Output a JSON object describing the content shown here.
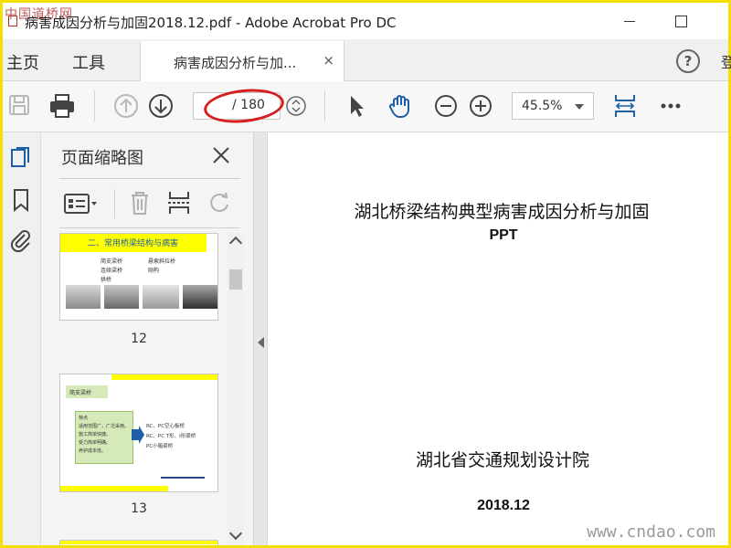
{
  "window": {
    "title": "病害成因分析与加固2018.12.pdf - Adobe Acrobat Pro DC",
    "watermark": "中国道桥网"
  },
  "nav": {
    "home_label": "主页",
    "tools_label": "工具",
    "doc_tab_label": "病害成因分析与加...",
    "doc_tab_close": "×",
    "help_label": "?",
    "login_label": "登"
  },
  "toolbar": {
    "page_total": "/ 180",
    "zoom_value": "45.5%"
  },
  "thumbnail_panel": {
    "title": "页面缩略图",
    "thumbnails": [
      {
        "page_number": "12",
        "heading": "二、常用桥梁结构与病害",
        "bullets_left": [
          "简支梁桥",
          "连续梁桥",
          "拱桥"
        ],
        "bullets_right": [
          "悬索斜拉桥",
          "刚构"
        ]
      },
      {
        "page_number": "13",
        "heading": "简支梁桥",
        "box_title": "特点",
        "box_lines": [
          "适用范围广，广泛采用。",
          "施工简单快捷。",
          "受力简单明确。",
          "养护成本低。"
        ],
        "bullets": [
          "RC、PC空心板桥",
          "RC、PC T形、I形梁桥",
          "PC小箱梁桥"
        ]
      }
    ]
  },
  "document": {
    "title": "湖北桥梁结构典型病害成因分析与加固",
    "subtitle": "PPT",
    "organization": "湖北省交通规划设计院",
    "date": "2018.12"
  },
  "footer_watermark": "www.cndao.com",
  "colors": {
    "frame_yellow": "#f2e000",
    "slide_yellow": "#ffff00",
    "highlight_red": "#d81e1e",
    "accent_blue": "#1f5fa8",
    "slide_green": "#d6e9b8"
  }
}
